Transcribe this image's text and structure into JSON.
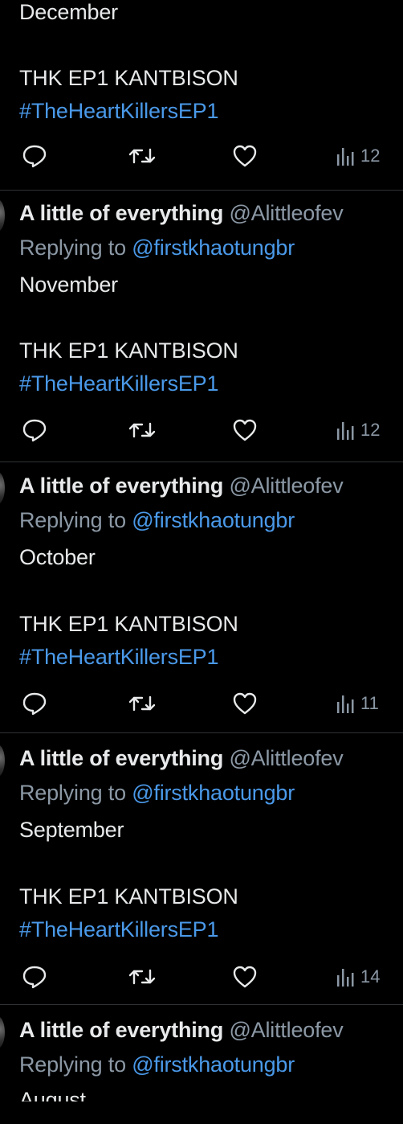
{
  "colors": {
    "background": "#000000",
    "text": "#e7e9ea",
    "muted": "#8b98a5",
    "link": "#4a99e9",
    "divider": "#2f3336"
  },
  "tweets": [
    {
      "author": "",
      "handle": "",
      "replying_label": "",
      "replying_to": "",
      "month": "December",
      "line1": "THK EP1 KANTBISON",
      "hashtag": "#TheHeartKillersEP1",
      "views": "12"
    },
    {
      "author": "A little of everything",
      "handle": "@Alittleofev",
      "replying_label": "Replying to",
      "replying_to": "@firstkhaotungbr",
      "month": "November",
      "line1": "THK EP1 KANTBISON",
      "hashtag": "#TheHeartKillersEP1",
      "views": "12"
    },
    {
      "author": "A little of everything",
      "handle": "@Alittleofev",
      "replying_label": "Replying to",
      "replying_to": "@firstkhaotungbr",
      "month": "October",
      "line1": "THK EP1 KANTBISON",
      "hashtag": "#TheHeartKillersEP1",
      "views": "11"
    },
    {
      "author": "A little of everything",
      "handle": "@Alittleofev",
      "replying_label": "Replying to",
      "replying_to": "@firstkhaotungbr",
      "month": "September",
      "line1": "THK EP1 KANTBISON",
      "hashtag": "#TheHeartKillersEP1",
      "views": "14"
    },
    {
      "author": "A little of everything",
      "handle": "@Alittleofev",
      "replying_label": "Replying to",
      "replying_to": "@firstkhaotungbr",
      "month": "August",
      "line1": "",
      "hashtag": "",
      "views": ""
    }
  ],
  "icons": {
    "reply": "reply-icon",
    "retweet": "retweet-icon",
    "like": "heart-icon",
    "views": "views-icon"
  }
}
